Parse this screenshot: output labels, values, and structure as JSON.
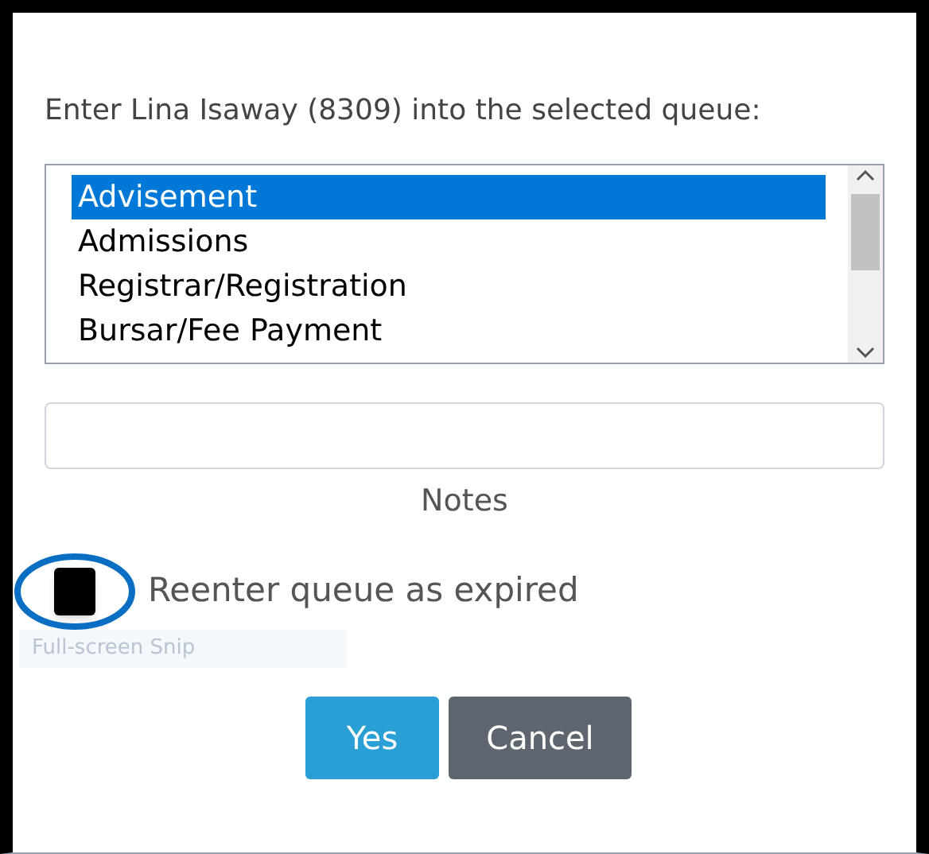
{
  "prompt": "Enter Lina Isaway (8309) into the selected queue:",
  "queues": [
    {
      "label": "Advisement",
      "selected": true
    },
    {
      "label": "Admissions",
      "selected": false
    },
    {
      "label": "Registrar/Registration",
      "selected": false
    },
    {
      "label": "Bursar/Fee Payment",
      "selected": false
    }
  ],
  "notes": {
    "label": "Notes"
  },
  "reenter": {
    "label": "Reenter queue as expired",
    "checked": true,
    "highlighted": true
  },
  "snip_tooltip": "Full-screen Snip",
  "buttons": [
    {
      "label": "Yes",
      "kind": "primary"
    },
    {
      "label": "Cancel",
      "kind": "secondary"
    }
  ]
}
